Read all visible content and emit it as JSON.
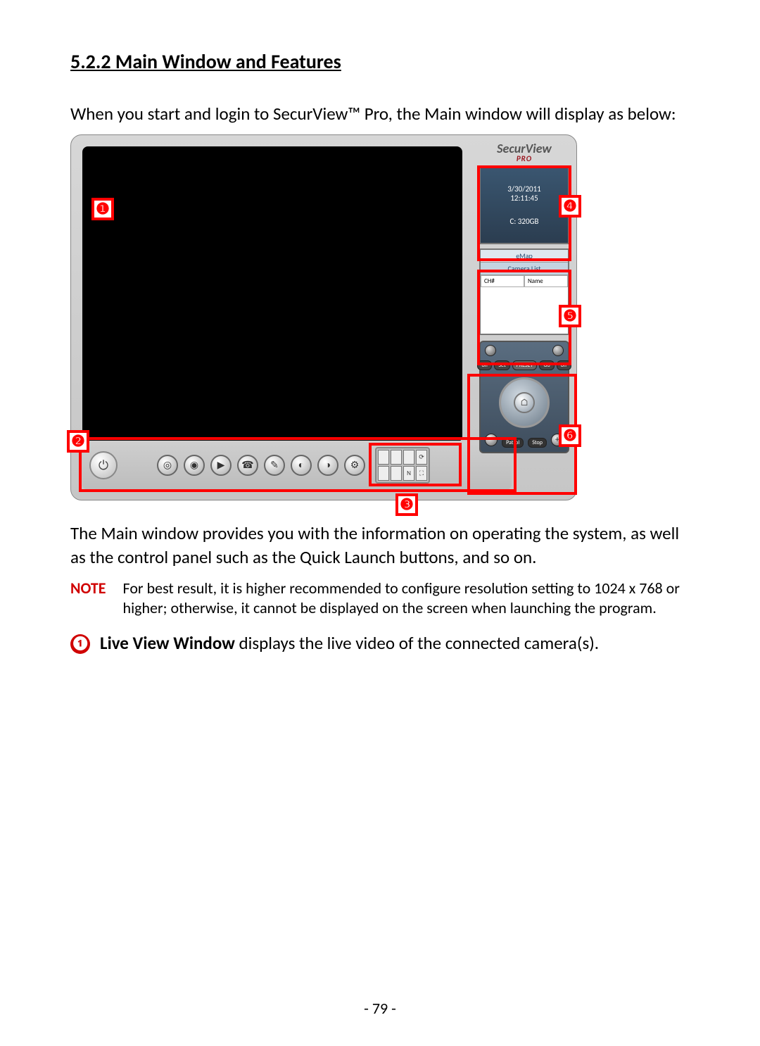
{
  "heading": "5.2.2 Main Window and Features",
  "intro": "When you start and login to SecurView™ Pro, the Main window will display as below:",
  "body_para": "The Main window provides you with the information on operating the system, as well as the control panel such as the Quick Launch buttons, and so on.",
  "note": {
    "label": "NOTE",
    "text": "For best result, it is higher recommended to configure resolution setting to 1024 x 768 or higher; otherwise, it cannot be displayed on the screen when launching the program."
  },
  "callout_1": {
    "num": "❶",
    "bold": "Live View Window",
    "rest": " displays the live video of the connected camera(s)."
  },
  "page_number": "- 79 -",
  "screenshot": {
    "brand_main": "SecurView",
    "brand_sub": "PRO",
    "info": {
      "date": "3/30/2011",
      "time": "12:11:45",
      "storage": "C: 320GB"
    },
    "tabs": {
      "emap": "eMap",
      "camera_list": "Camera List"
    },
    "list_headers": {
      "ch": "CH#",
      "name": "Name"
    },
    "preset": {
      "set": "Set",
      "preset": "PRESET",
      "go": "Go",
      "off1": "off",
      "off2": "off"
    },
    "ptz": {
      "patrol": "Patrol",
      "stop": "Stop"
    },
    "layout_cells": [
      "",
      "",
      "",
      "⟳",
      "",
      "",
      "N",
      "⛶"
    ]
  },
  "badges": {
    "b1": "❶",
    "b2": "❷",
    "b3": "❸",
    "b4": "❹",
    "b5": "❺",
    "b6": "❻"
  }
}
